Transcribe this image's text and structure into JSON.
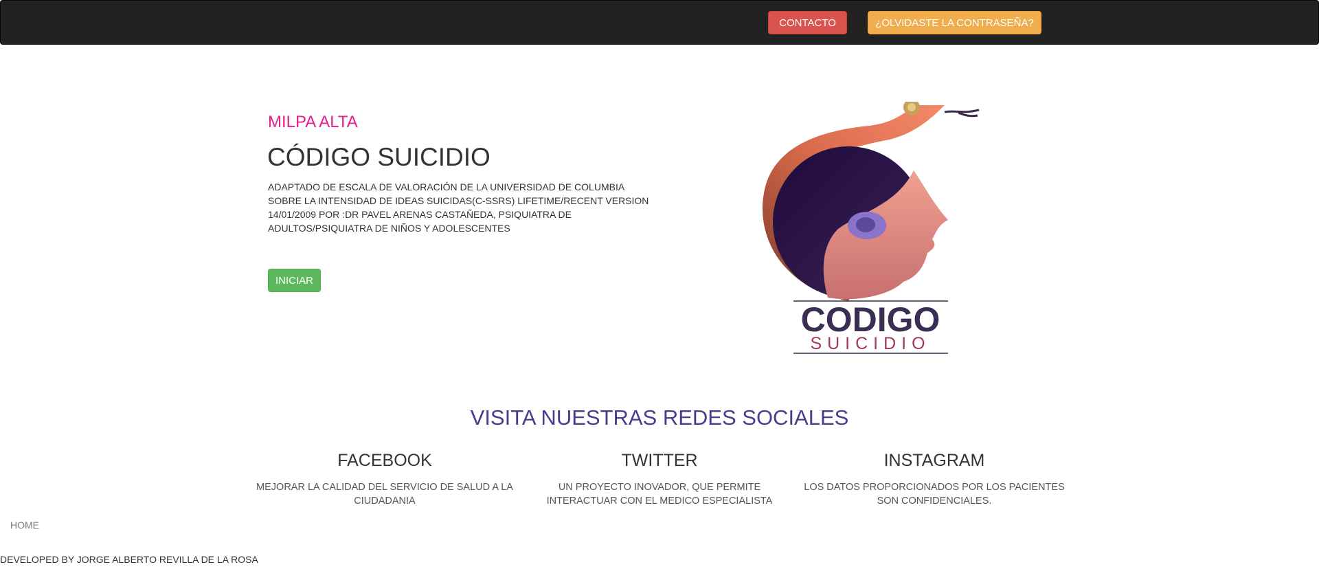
{
  "navbar": {
    "contact_label": "CONTACTO",
    "forgot_password_label": "¿OLVIDASTE LA CONTRASEÑA?"
  },
  "hero": {
    "location": "MILPA ALTA",
    "title": "CÓDIGO SUICIDIO",
    "description": "ADAPTADO DE ESCALA DE VALORACIÓN DE LA UNIVERSIDAD DE COLUMBIA SOBRE LA INTENSIDAD DE IDEAS SUICIDAS(C-SSRS) LIFETIME/RECENT VERSION 14/01/2009 POR :DR PAVEL ARENAS CASTAÑEDA, PSIQUIATRA DE ADULTOS/PSIQUIATRA DE NIÑOS Y ADOLESCENTES",
    "start_label": "INICIAR"
  },
  "logo": {
    "word1": "CODIGO",
    "word2": "SUICIDIO"
  },
  "social": {
    "heading": "VISITA NUESTRAS REDES SOCIALES",
    "columns": [
      {
        "title": "FACEBOOK",
        "text": "MEJORAR LA CALIDAD DEL SERVICIO DE SALUD A LA CIUDADANIA"
      },
      {
        "title": "TWITTER",
        "text": "UN PROYECTO INOVADOR, QUE PERMITE INTERACTUAR CON EL MEDICO ESPECIALISTA"
      },
      {
        "title": "INSTAGRAM",
        "text": "LOS DATOS PROPORCIONADOS POR LOS PACIENTES SON CONFIDENCIALES."
      }
    ]
  },
  "footer": {
    "home_label": "HOME",
    "credits": "DEVELOPED BY JORGE ALBERTO REVILLA DE LA ROSA"
  },
  "colors": {
    "navbar": "#222222",
    "contact_button": "#d9534f",
    "forgot_button": "#f0ad4e",
    "start_button": "#5cb85c",
    "location_text": "#e91e8c",
    "social_heading": "#4a3c8c"
  }
}
